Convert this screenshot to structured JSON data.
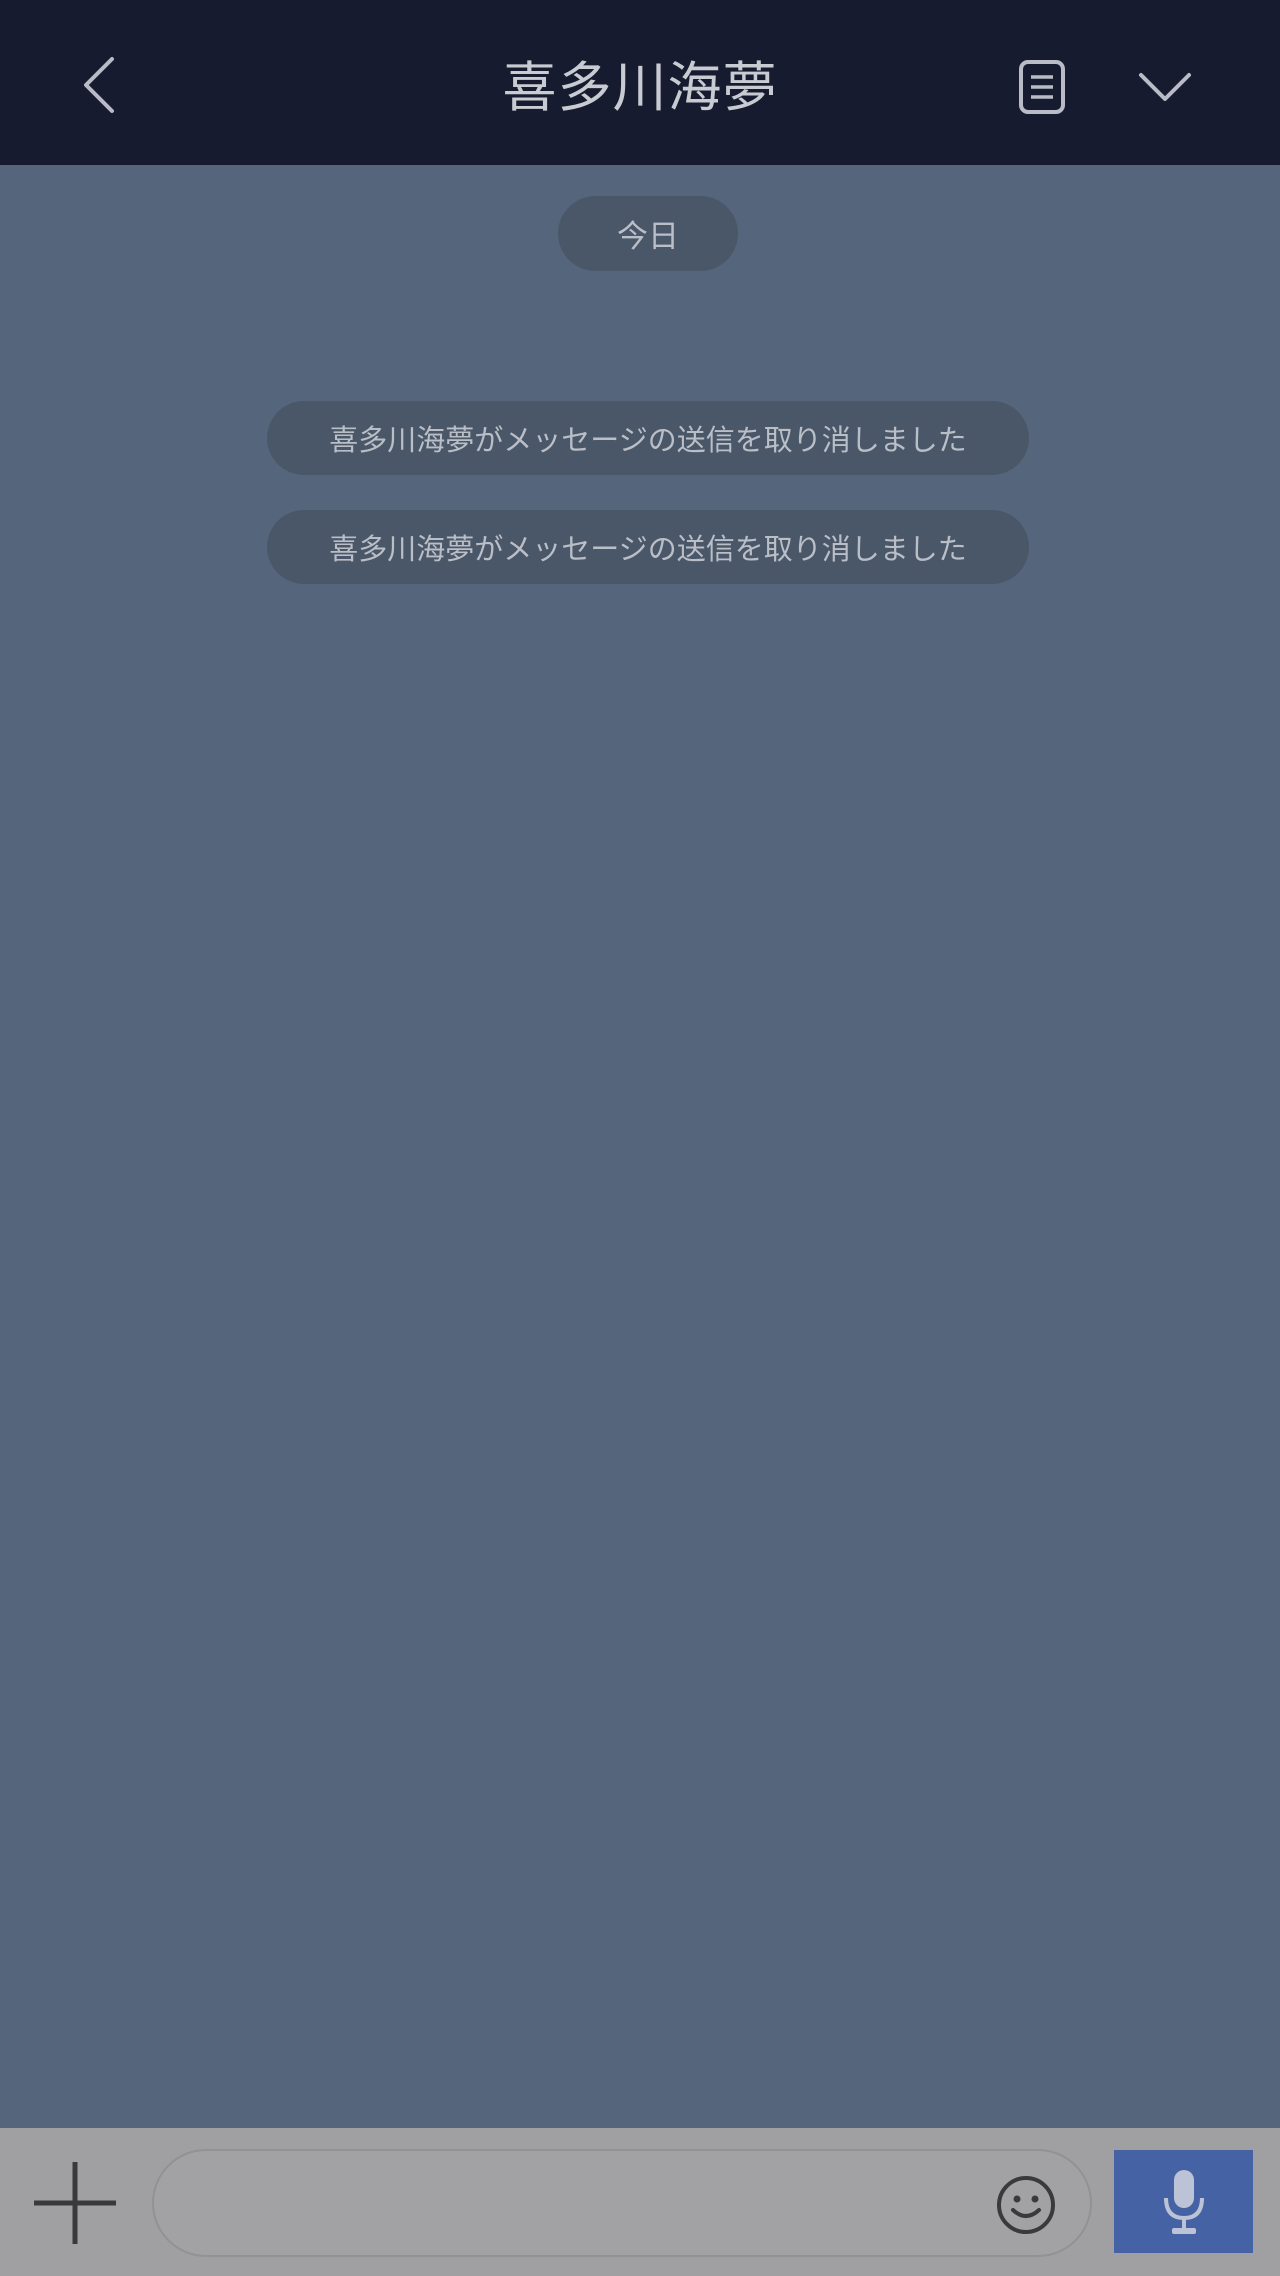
{
  "header": {
    "title": "喜多川海夢",
    "back_icon": "chevron-left-icon",
    "notes_icon": "notes-icon",
    "menu_icon": "chevron-down-icon"
  },
  "chat": {
    "date_label": "今日",
    "system_messages": [
      "喜多川海夢がメッセージの送信を取り消しました",
      "喜多川海夢がメッセージの送信を取り消しました"
    ]
  },
  "input_bar": {
    "plus_icon": "plus-icon",
    "message_value": "",
    "emoji_icon": "emoji-icon",
    "mic_icon": "microphone-icon"
  },
  "colors": {
    "header_bg": "#171b2f",
    "chat_bg": "#55657c",
    "pill_bg": "#4a5768",
    "input_bar_bg": "#a0a0a2",
    "mic_button_bg": "#4563a4"
  }
}
